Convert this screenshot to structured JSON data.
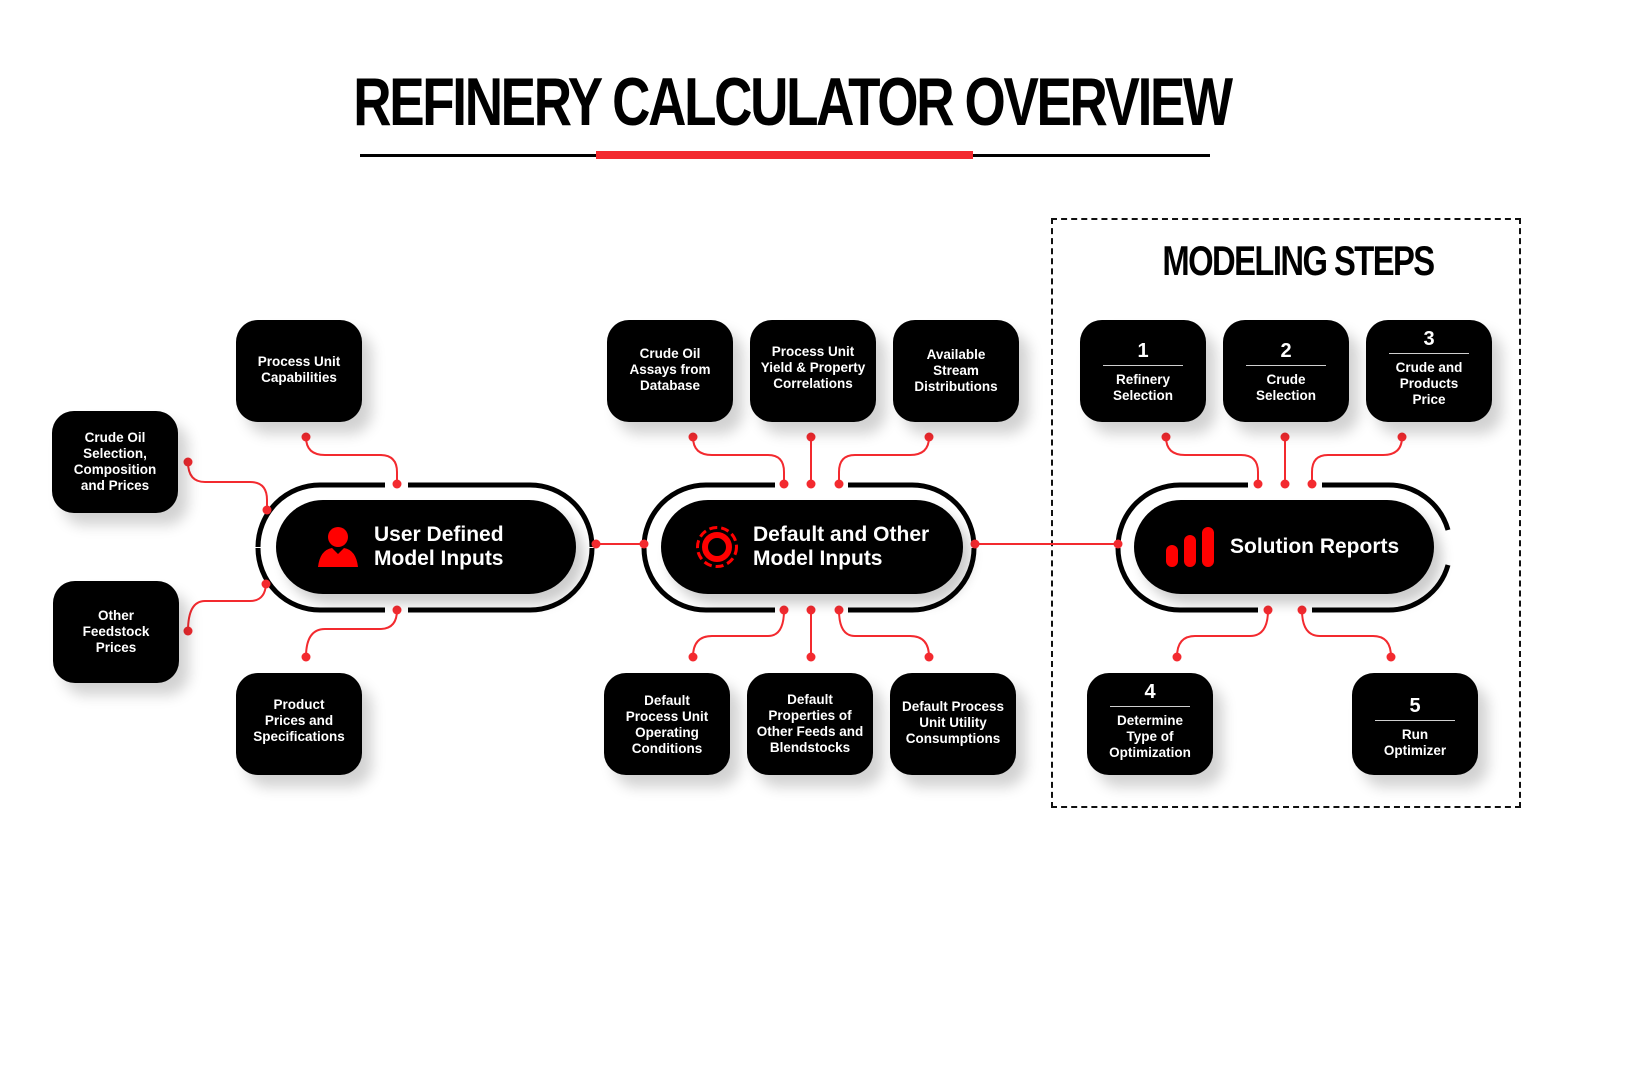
{
  "title": "REFINERY CALCULATOR OVERVIEW",
  "colors": {
    "accent": "#f32a2f",
    "card_bg": "#000000",
    "card_text": "#ffffff",
    "background": "#ffffff"
  },
  "hubs": {
    "user_defined": {
      "label": "User Defined\nModel Inputs",
      "icon": "user-icon"
    },
    "default_other": {
      "label": "Default and Other\nModel Inputs",
      "icon": "gear-ring-icon"
    },
    "solution": {
      "label": "Solution Reports",
      "icon": "bar-chart-icon"
    }
  },
  "user_inputs": [
    {
      "label": "Process Unit\nCapabilities"
    },
    {
      "label": "Crude Oil\nSelection,\nComposition\nand Prices"
    },
    {
      "label": "Other\nFeedstock\nPrices"
    },
    {
      "label": "Product\nPrices and\nSpecifications"
    }
  ],
  "default_inputs_top": [
    {
      "label": "Crude Oil\nAssays from\nDatabase"
    },
    {
      "label": "Process Unit\nYield & Property\nCorrelations"
    },
    {
      "label": "Available\nStream\nDistributions"
    }
  ],
  "default_inputs_bottom": [
    {
      "label": "Default\nProcess Unit\nOperating\nConditions"
    },
    {
      "label": "Default\nProperties of\nOther Feeds and\nBlendstocks"
    },
    {
      "label": "Default Process\nUnit Utility\nConsumptions"
    }
  ],
  "modeling_steps": {
    "title": "MODELING STEPS",
    "steps": [
      {
        "number": "1",
        "label": "Refinery\nSelection"
      },
      {
        "number": "2",
        "label": "Crude\nSelection"
      },
      {
        "number": "3",
        "label": "Crude and\nProducts\nPrice"
      },
      {
        "number": "4",
        "label": "Determine\nType of\nOptimization"
      },
      {
        "number": "5",
        "label": "Run\nOptimizer"
      }
    ]
  }
}
